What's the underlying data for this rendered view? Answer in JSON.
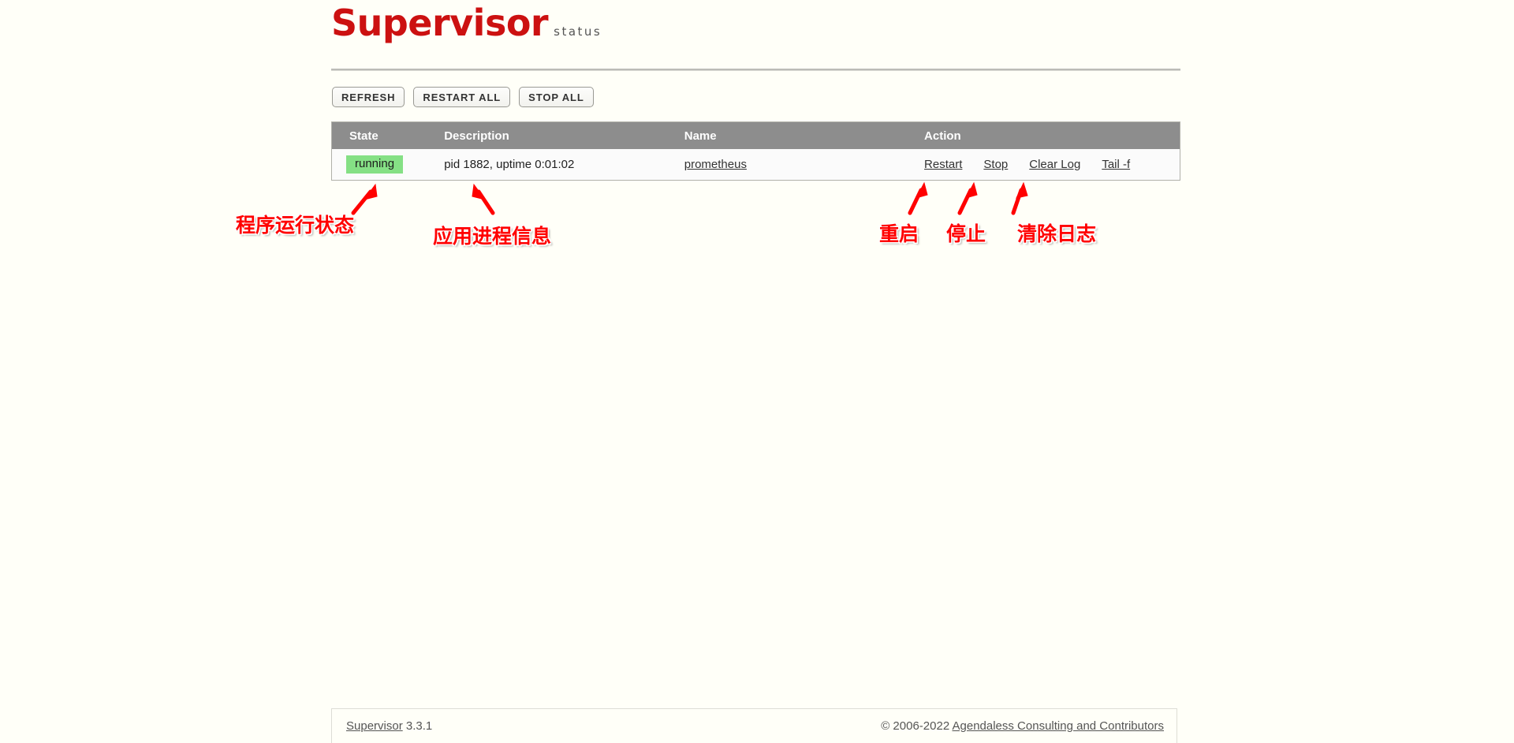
{
  "header": {
    "logo_main": "Supervisor",
    "logo_sub": "status"
  },
  "toolbar": {
    "buttons": [
      {
        "label": "REFRESH",
        "name": "refresh-button"
      },
      {
        "label": "RESTART ALL",
        "name": "restart-all-button"
      },
      {
        "label": "STOP ALL",
        "name": "stop-all-button"
      }
    ]
  },
  "table": {
    "headers": {
      "state": "State",
      "description": "Description",
      "name": "Name",
      "action": "Action"
    },
    "rows": [
      {
        "state": "running",
        "state_color": "#85e085",
        "description": "pid 1882, uptime 0:01:02",
        "name": "prometheus",
        "actions": [
          "Restart",
          "Stop",
          "Clear Log",
          "Tail -f"
        ]
      }
    ]
  },
  "annotations": [
    {
      "text": "程序运行状态"
    },
    {
      "text": "应用进程信息"
    },
    {
      "text": "重启"
    },
    {
      "text": "停止"
    },
    {
      "text": "清除日志"
    }
  ],
  "footer": {
    "product_link": "Supervisor",
    "version": " 3.3.1",
    "copyright": "© 2006-2022 ",
    "credit_link": "Agendaless Consulting and Contributors"
  },
  "colors": {
    "background": "#fffff8",
    "brand_red": "#cc1111",
    "header_gray": "#8d8d8d",
    "annotation_red": "#ff0000"
  }
}
